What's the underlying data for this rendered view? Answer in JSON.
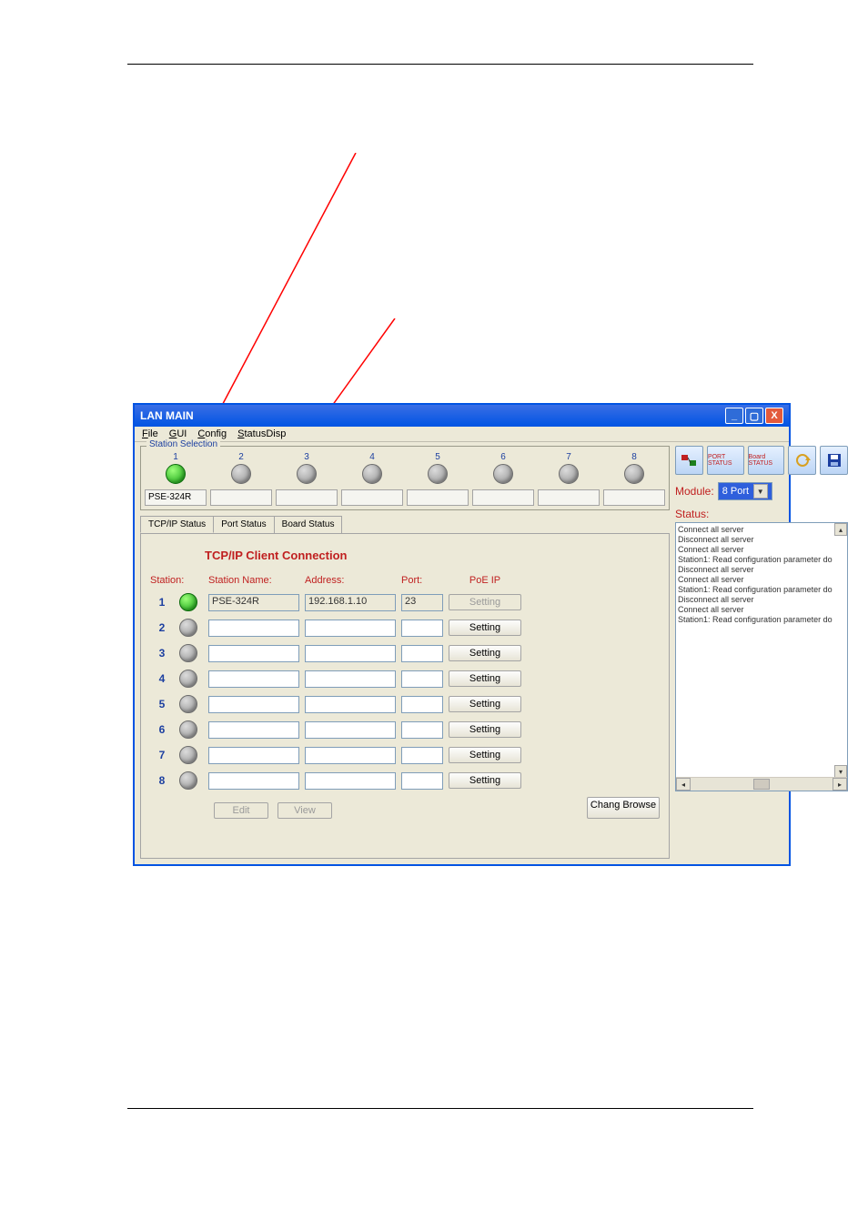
{
  "window": {
    "title": "LAN MAIN"
  },
  "menu": {
    "file": "File",
    "gui": "GUI",
    "config": "Config",
    "statusdisp": "StatusDisp"
  },
  "station_selection": {
    "legend": "Station Selection",
    "numbers": [
      "1",
      "2",
      "3",
      "4",
      "5",
      "6",
      "7",
      "8"
    ],
    "name_boxes": [
      "PSE-324R",
      "",
      "",
      "",
      "",
      "",
      "",
      ""
    ]
  },
  "tabs": {
    "tcpip": "TCP/IP Status",
    "port": "Port Status",
    "board": "Board Status"
  },
  "panel": {
    "title": "TCP/IP Client Connection",
    "headers": {
      "station": "Station:",
      "station_name": "Station Name:",
      "address": "Address:",
      "port": "Port:",
      "poe_ip": "PoE IP"
    },
    "rows": [
      {
        "num": "1",
        "name": "PSE-324R",
        "addr": "192.168.1.10",
        "port": "23",
        "btn": "Setting",
        "green": true,
        "disabled": true
      },
      {
        "num": "2",
        "name": "",
        "addr": "",
        "port": "",
        "btn": "Setting",
        "green": false,
        "disabled": false
      },
      {
        "num": "3",
        "name": "",
        "addr": "",
        "port": "",
        "btn": "Setting",
        "green": false,
        "disabled": false
      },
      {
        "num": "4",
        "name": "",
        "addr": "",
        "port": "",
        "btn": "Setting",
        "green": false,
        "disabled": false
      },
      {
        "num": "5",
        "name": "",
        "addr": "",
        "port": "",
        "btn": "Setting",
        "green": false,
        "disabled": false
      },
      {
        "num": "6",
        "name": "",
        "addr": "",
        "port": "",
        "btn": "Setting",
        "green": false,
        "disabled": false
      },
      {
        "num": "7",
        "name": "",
        "addr": "",
        "port": "",
        "btn": "Setting",
        "green": false,
        "disabled": false
      },
      {
        "num": "8",
        "name": "",
        "addr": "",
        "port": "",
        "btn": "Setting",
        "green": false,
        "disabled": false
      }
    ],
    "edit_btn": "Edit",
    "view_btn": "View",
    "chang_browse_btn": "Chang Browse"
  },
  "right": {
    "module_label": "Module:",
    "module_value": "8 Port",
    "status_label": "Status:",
    "status_lines": [
      "Connect all server",
      "Disconnect all server",
      "Connect all server",
      "Station1: Read configuration parameter do",
      "Disconnect all server",
      "Connect all server",
      "Station1: Read configuration parameter do",
      "Disconnect all server",
      "Connect all server",
      "Station1: Read configuration parameter do"
    ],
    "tool_port_status": "PORT STATUS",
    "tool_board_status": "Board STATUS"
  }
}
